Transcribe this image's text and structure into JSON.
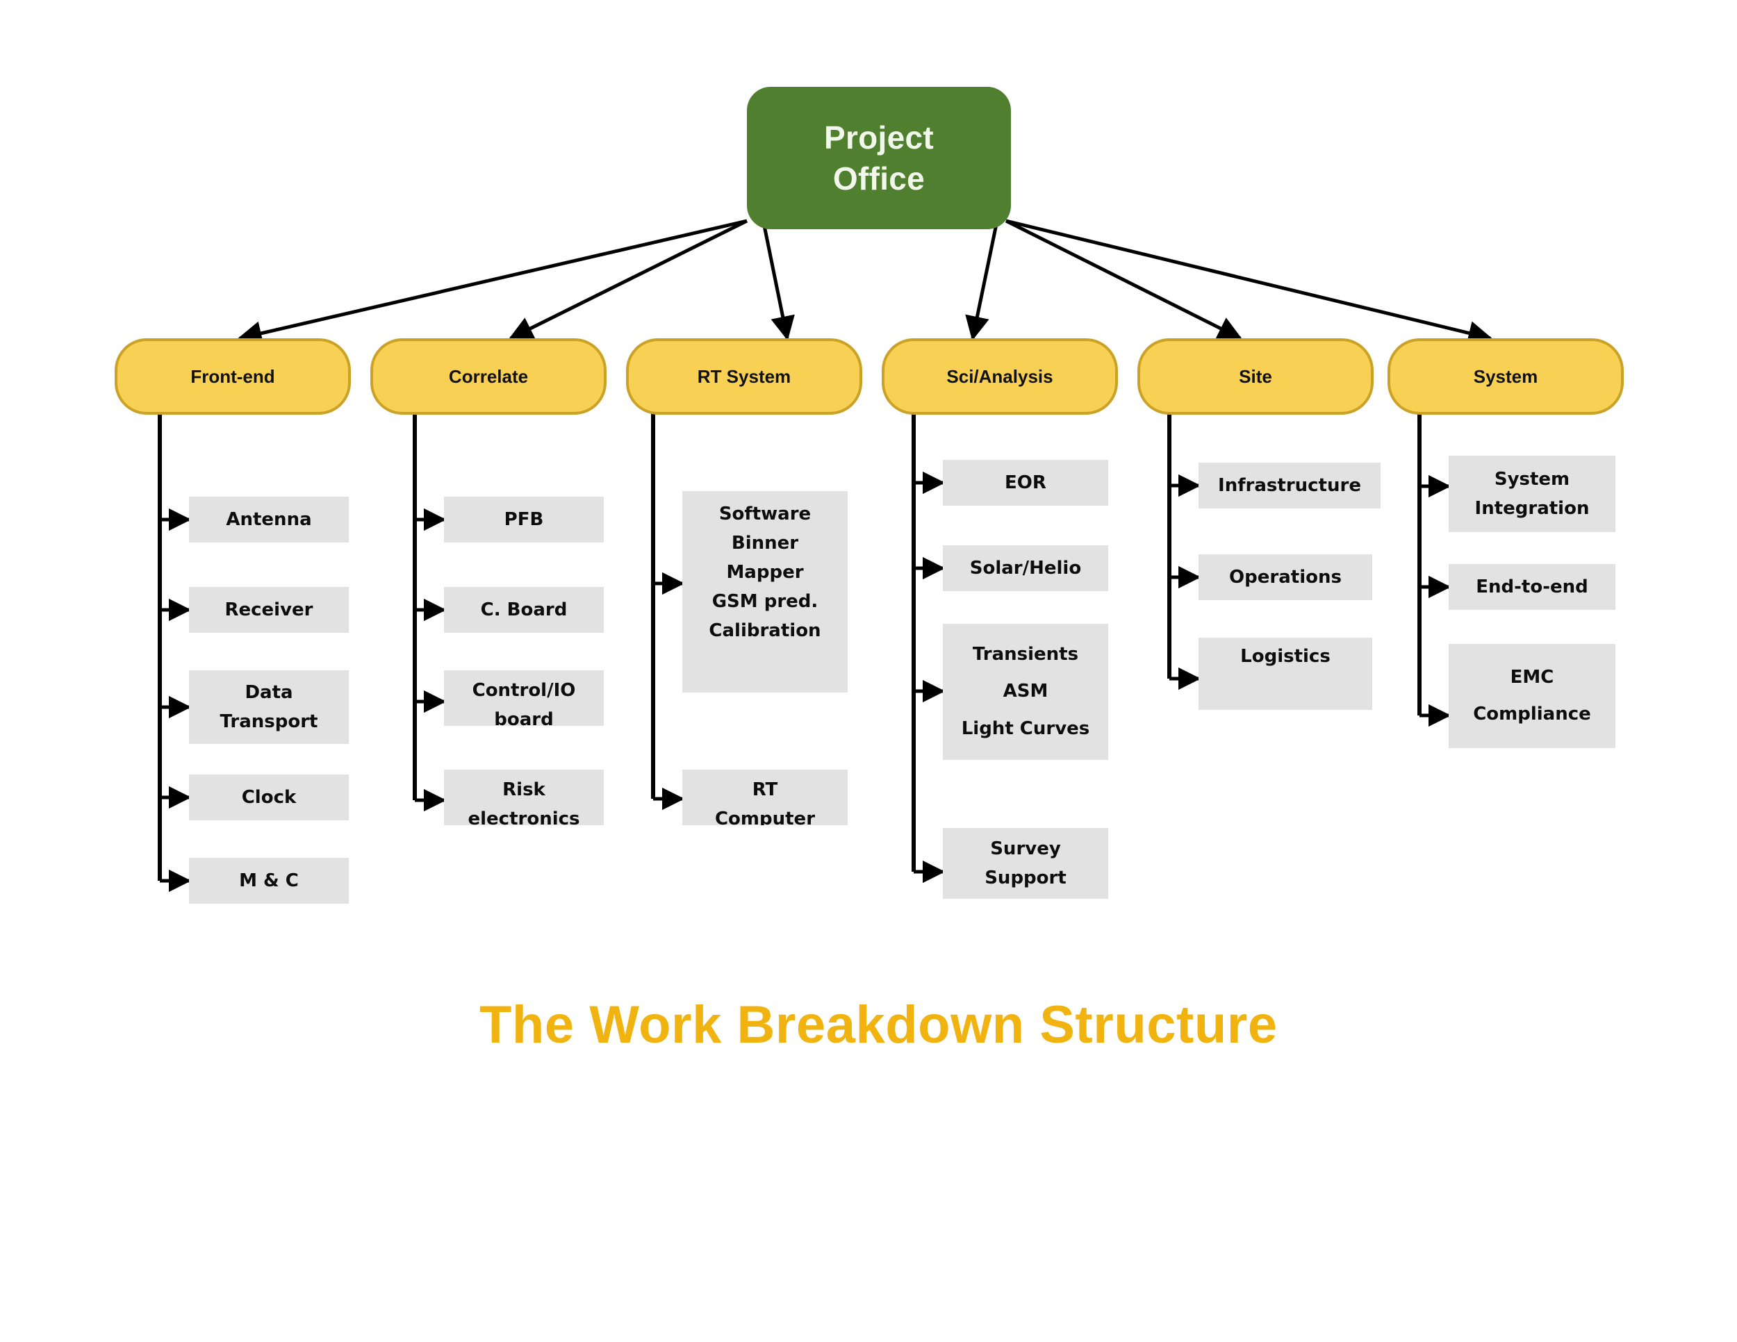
{
  "caption": "The Work Breakdown Structure",
  "colors": {
    "root_fill": "#4F7F2F",
    "root_text": "#F2F7EC",
    "category_fill": "#F8D154",
    "category_border": "#C9A227",
    "leaf_fill": "#E2E2E2",
    "leaf_text": "#0D0D0D",
    "caption_text": "#F0B310",
    "connector": "#000000",
    "background": "#FFFFFF"
  },
  "root": {
    "line1": "Project",
    "line2": "Office"
  },
  "categories": [
    {
      "label": "Front-end"
    },
    {
      "label": "Correlate"
    },
    {
      "label": "RT System"
    },
    {
      "label": "Sci/Analysis"
    },
    {
      "label": "Site"
    },
    {
      "label": "System"
    }
  ],
  "leaves": {
    "front_end": [
      {
        "lines": [
          "Antenna"
        ]
      },
      {
        "lines": [
          "Receiver"
        ]
      },
      {
        "lines": [
          "Data",
          "Transport"
        ]
      },
      {
        "lines": [
          "Clock"
        ]
      },
      {
        "lines": [
          "M & C"
        ]
      }
    ],
    "correlate": [
      {
        "lines": [
          "PFB"
        ]
      },
      {
        "lines": [
          "C. Board"
        ]
      },
      {
        "lines": [
          "Control/IO",
          "board"
        ]
      },
      {
        "lines": [
          "Risk",
          "electronics"
        ]
      }
    ],
    "rt_system": [
      {
        "lines": [
          "Software",
          "Binner",
          "Mapper",
          "GSM pred.",
          "Calibration"
        ]
      },
      {
        "lines": [
          "RT",
          "Computer"
        ]
      }
    ],
    "sci_analysis": [
      {
        "lines": [
          "EOR"
        ]
      },
      {
        "lines": [
          "Solar/Helio"
        ]
      },
      {
        "lines": [
          "Transients",
          "ASM",
          "Light Curves"
        ]
      },
      {
        "lines": [
          "Survey",
          "Support"
        ]
      }
    ],
    "site": [
      {
        "lines": [
          "Infrastructure"
        ]
      },
      {
        "lines": [
          "Operations"
        ]
      },
      {
        "lines": [
          "Logistics"
        ]
      }
    ],
    "system": [
      {
        "lines": [
          "System",
          "Integration"
        ]
      },
      {
        "lines": [
          "End-to-end"
        ]
      },
      {
        "lines": [
          "EMC",
          "Compliance"
        ]
      }
    ]
  }
}
